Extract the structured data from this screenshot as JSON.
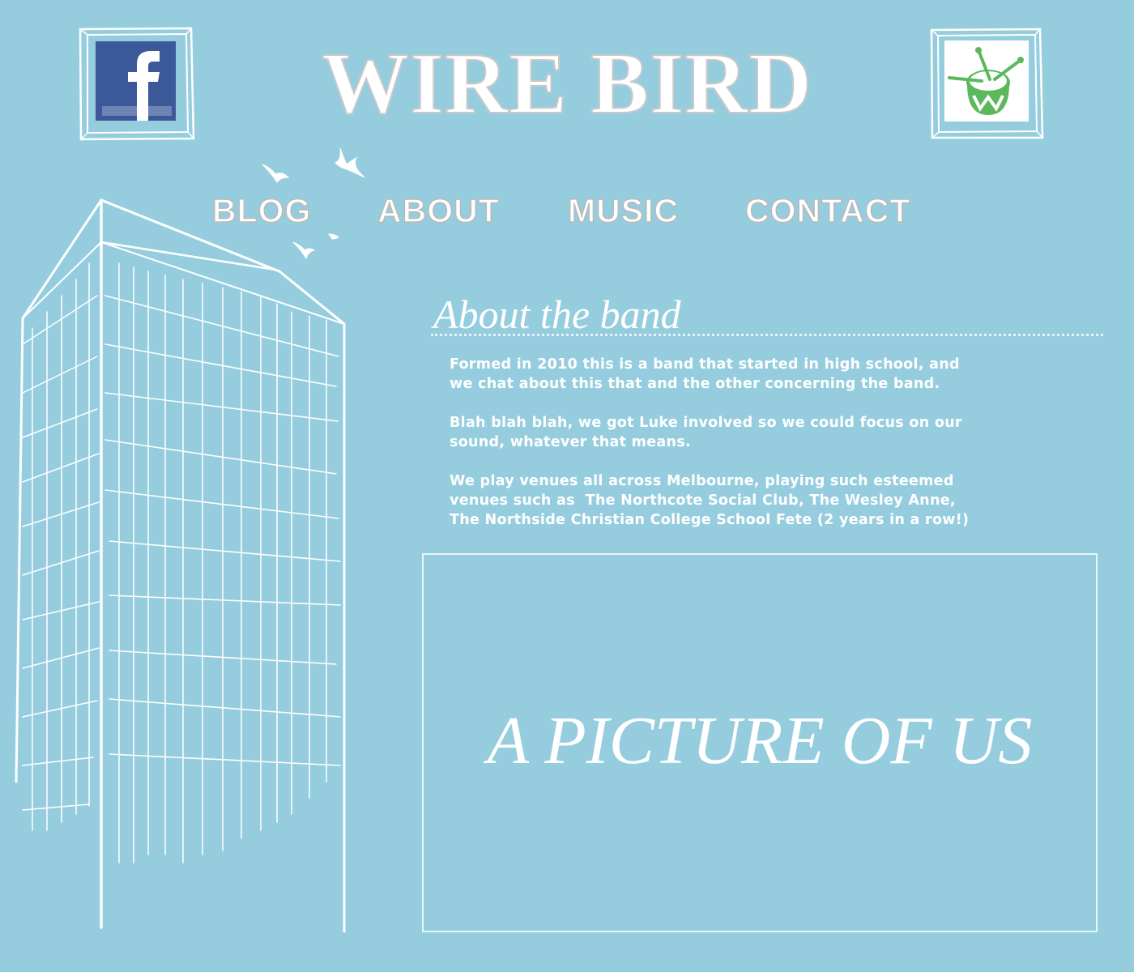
{
  "header": {
    "title": "WIRE BIRD"
  },
  "social": {
    "facebook_icon": "facebook-icon",
    "triplej_icon": "triple-j-drum-icon"
  },
  "nav": {
    "items": [
      {
        "label": "BLOG"
      },
      {
        "label": "ABOUT"
      },
      {
        "label": "MUSIC"
      },
      {
        "label": "CONTACT"
      }
    ]
  },
  "about": {
    "heading": "About the band",
    "paragraphs": [
      "Formed in 2010 this is a band that started in high school, and\nwe chat about this that and the other concerning the band.",
      "Blah blah blah, we got Luke involved so we could focus on our\nsound, whatever that means.",
      "We play venues all across Melbourne, playing such esteemed\nvenues such as  The Northcote Social Club, The Wesley Anne,\nThe Northside Christian College School Fete (2 years in a row!)"
    ]
  },
  "picture": {
    "label": "A PICTURE OF US"
  },
  "colors": {
    "background": "#95cddf",
    "text": "#ffffff",
    "facebook_blue": "#3b5998",
    "triplej_green": "#5cb85c"
  }
}
